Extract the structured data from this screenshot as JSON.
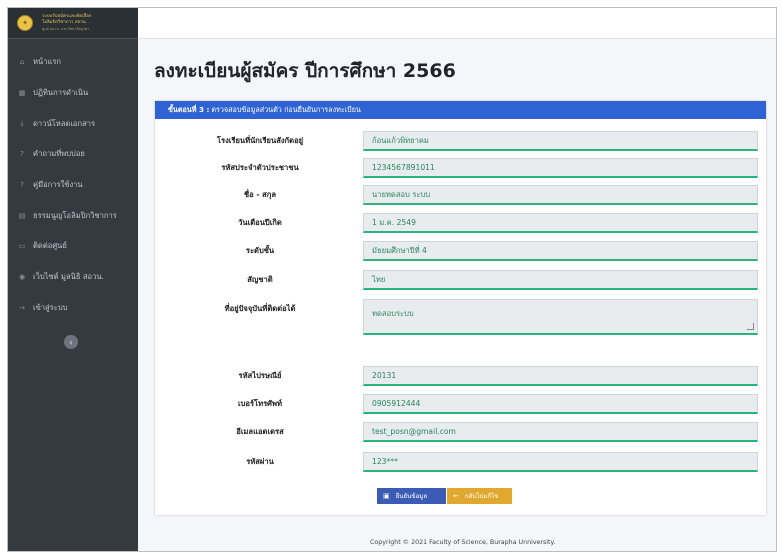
{
  "brand": {
    "lines": [
      "ระบบรับสมัครและคัดเลือก",
      "โอลิมปิกวิชาการ สอวน.",
      "ศูนย์ สอวน. มหาวิทยาลัยบูรพา"
    ]
  },
  "sidebar": {
    "items": [
      {
        "label": "หน้าแรก",
        "icon": "home-icon",
        "glyph": "⌂"
      },
      {
        "label": "ปฏิทินการดำเนิน",
        "icon": "calendar-icon",
        "glyph": "▦"
      },
      {
        "label": "ดาวน์โหลดเอกสาร",
        "icon": "download-icon",
        "glyph": "⤓"
      },
      {
        "label": "คำถามที่พบบ่อย",
        "icon": "question-icon",
        "glyph": "?"
      },
      {
        "label": "คู่มือการใช้งาน",
        "icon": "manual-icon",
        "glyph": "?"
      },
      {
        "label": "ธรรมนูญโอลิมปิกวิชาการ",
        "icon": "book-icon",
        "glyph": "▤"
      },
      {
        "label": "ติดต่อศูนย์",
        "icon": "contact-icon",
        "glyph": "▭"
      },
      {
        "label": "เว็บไซต์ มูลนิธิ สอวน.",
        "icon": "globe-icon",
        "glyph": "◉"
      },
      {
        "label": "เข้าสู่ระบบ",
        "icon": "login-icon",
        "glyph": "→"
      }
    ],
    "collapse_glyph": "‹"
  },
  "page": {
    "title": "ลงทะเบียนผู้สมัคร ปีการศึกษา 2566"
  },
  "card": {
    "step_label": "ขั้นตอนที่ 3 :",
    "step_text": "ตรวจสอบข้อมูลส่วนตัว ก่อนยืนยันการลงทะเบียน"
  },
  "form": {
    "fields": [
      {
        "label": "โรงเรียนที่นักเรียนสังกัดอยู่",
        "value": "ก้อนแก้วพิทยาคม"
      },
      {
        "label": "รหัสประจำตัวประชาชน",
        "value": "1234567891011"
      },
      {
        "label": "ชื่อ - สกุล",
        "value": "นายทดสอบ ระบบ"
      },
      {
        "label": "วันเดือนปีเกิด",
        "value": "1 ม.ค. 2549"
      },
      {
        "label": "ระดับชั้น",
        "value": "มัธยมศึกษาปีที่ 4"
      },
      {
        "label": "สัญชาติ",
        "value": "ไทย"
      },
      {
        "label": "ที่อยู่ปัจจุบันที่ติดต่อได้",
        "value": "ทดสอบระบบ"
      },
      {
        "label": "รหัสไปรษณีย์",
        "value": "20131"
      },
      {
        "label": "เบอร์โทรศัพท์",
        "value": "0905912444"
      },
      {
        "label": "อีเมลแอดเดรส",
        "value": "test_posn@gmail.com"
      },
      {
        "label": "รหัสผ่าน",
        "value": "123***"
      }
    ]
  },
  "buttons": {
    "confirm": "ยืนยันข้อมูล",
    "back": "กลับไปแก้ไข"
  },
  "footer": {
    "text": "Copyright © 2021 Faculty of Science, Burapha Unniversity."
  },
  "colors": {
    "sidebar_bg": "#343a40",
    "header_blue": "#2f63d4",
    "field_underline": "#28b47a",
    "button_primary": "#3b5bb5",
    "button_warning": "#e0a82e"
  }
}
